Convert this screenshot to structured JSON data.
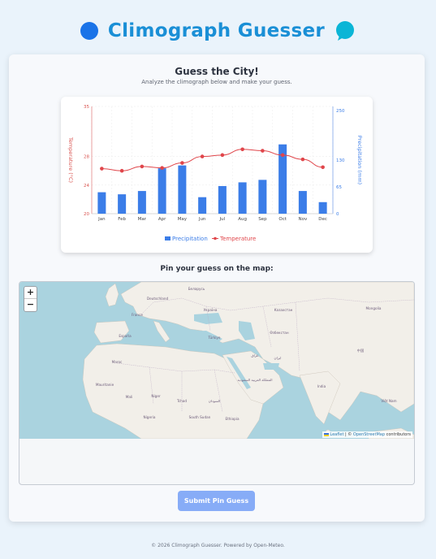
{
  "header": {
    "title": "Climograph Guesser",
    "logo_left_icon": "blue-circle-icon",
    "logo_right_icon": "speech-bubble-icon",
    "accent": "#1a8fd6"
  },
  "card": {
    "title": "Guess the City!",
    "subtitle": "Analyze the climograph below and make your guess.",
    "map_label": "Pin your guess on the map:",
    "submit_label": "Submit Pin Guess"
  },
  "chart_data": {
    "type": "bar",
    "categories": [
      "Jan",
      "Feb",
      "Mar",
      "Apr",
      "May",
      "Jun",
      "Jul",
      "Aug",
      "Sep",
      "Oct",
      "Nov",
      "Dec"
    ],
    "series": [
      {
        "name": "Precipitation",
        "kind": "bar",
        "axis": "right",
        "color": "#3b7de8",
        "values": [
          52,
          47,
          55,
          110,
          117,
          40,
          67,
          76,
          82,
          168,
          55,
          28
        ]
      },
      {
        "name": "Temperature",
        "kind": "line",
        "axis": "left",
        "color": "#e0464b",
        "values": [
          26.3,
          26.0,
          26.6,
          26.4,
          27.1,
          28.0,
          28.2,
          29.0,
          28.8,
          28.2,
          27.6,
          26.5
        ]
      }
    ],
    "ylabel_left": "Temperature (°C)",
    "ylabel_right": "Precipitation (mm)",
    "y_left_ticks": [
      "20",
      "24",
      "28",
      "35"
    ],
    "y_left_range": [
      20,
      35
    ],
    "y_right_ticks": [
      "0",
      "65",
      "130",
      "250"
    ],
    "y_right_range": [
      0,
      260
    ],
    "grid": true,
    "legend_position": "bottom"
  },
  "map": {
    "zoom_in": "+",
    "zoom_out": "−",
    "attribution_leaflet": "Leaflet",
    "attribution_sep": " | © ",
    "attribution_osm": "OpenStreetMap",
    "attribution_rest": " contributors",
    "labels": [
      "Deutschland",
      "Беларусь",
      "France",
      "Україна",
      "España",
      "Казахстан",
      "Türkiye",
      "Өзбекстан",
      "Mongolia",
      "عراق",
      "ایران",
      "Maroc",
      "المملكة العربية السعودية",
      "India",
      "Mauritanie",
      "Mali",
      "Niger",
      "Tchad",
      "السودان",
      "Nigeria",
      "South Sudan",
      "Ethiopia",
      "中国",
      "Việt Nam"
    ]
  },
  "footer": {
    "text": "© 2026 Climograph Guesser. Powered by Open-Meteo."
  }
}
